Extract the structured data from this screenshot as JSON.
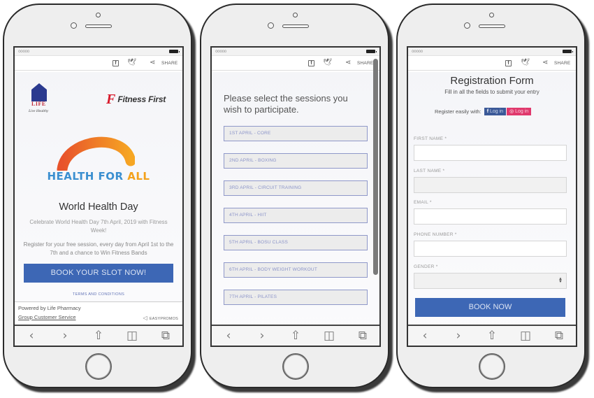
{
  "browser": {
    "status_signal": "ooooo",
    "share_label": "SHARE",
    "icons": [
      "facebook-icon",
      "twitter-icon",
      "share-icon"
    ],
    "toolbar_icons": {
      "back": "‹",
      "forward": "›",
      "share": "⇧",
      "bookmarks": "◫",
      "tabs": "⧉"
    },
    "toolbar_names": [
      "back-icon",
      "forward-icon",
      "share-icon",
      "bookmarks-icon",
      "tabs-icon"
    ]
  },
  "landing": {
    "life_logo_text": "LIFE",
    "life_tagline": "Live Healthy",
    "fitness_first_mark": "F",
    "fitness_first_text": "Fitness First",
    "campaign_part1": "HEALTH FOR ",
    "campaign_part2": "ALL",
    "title": "World Health Day",
    "description": "Celebrate World Health Day 7th April, 2019 with Fitness Week!",
    "register_text": "Register for your free session, every day from April 1st to the 7th and a chance to Win Fitness Bands",
    "cta_label": "BOOK YOUR SLOT NOW!",
    "terms_label": "TERMS AND CONDITIONS",
    "powered_by": "Powered by Life Pharmacy",
    "customer_service": "Group Customer Service",
    "easypromos": "EASYPROMOS",
    "colors": {
      "cta": "#3d67b5",
      "arc_start": "#e8532b",
      "arc_end": "#f6a623",
      "health_blue": "#3b8fd0",
      "all_orange": "#f3a11b"
    }
  },
  "sessions": {
    "title": "Please select the sessions you wish to participate.",
    "items": [
      {
        "label": "1ST APRIL - CORE"
      },
      {
        "label": "2ND APRIL - BOXING"
      },
      {
        "label": "3RD APRIL - CIRCUIT TRAINING"
      },
      {
        "label": "4TH APRIL - HIIT"
      },
      {
        "label": "5TH APRIL - BOSU CLASS"
      },
      {
        "label": "6TH APRIL - BODY WEIGHT WORKOUT"
      },
      {
        "label": "7TH APRIL - PILATES"
      }
    ]
  },
  "registration": {
    "title": "Registration Form",
    "subtitle": "Fill in all the fields to submit your entry",
    "register_easily": "Register easily with:",
    "facebook_login": "Log in",
    "instagram_login": "Log in",
    "fields": [
      {
        "label": "FIRST NAME *",
        "value": ""
      },
      {
        "label": "LAST NAME *",
        "value": ""
      },
      {
        "label": "EMAIL *",
        "value": ""
      },
      {
        "label": "PHONE NUMBER *",
        "value": ""
      },
      {
        "label": "GENDER *",
        "value": ""
      }
    ],
    "submit_label": "BOOK NOW",
    "colors": {
      "facebook": "#3b5998",
      "instagram": "#e0396d",
      "submit": "#3d67b5"
    }
  }
}
